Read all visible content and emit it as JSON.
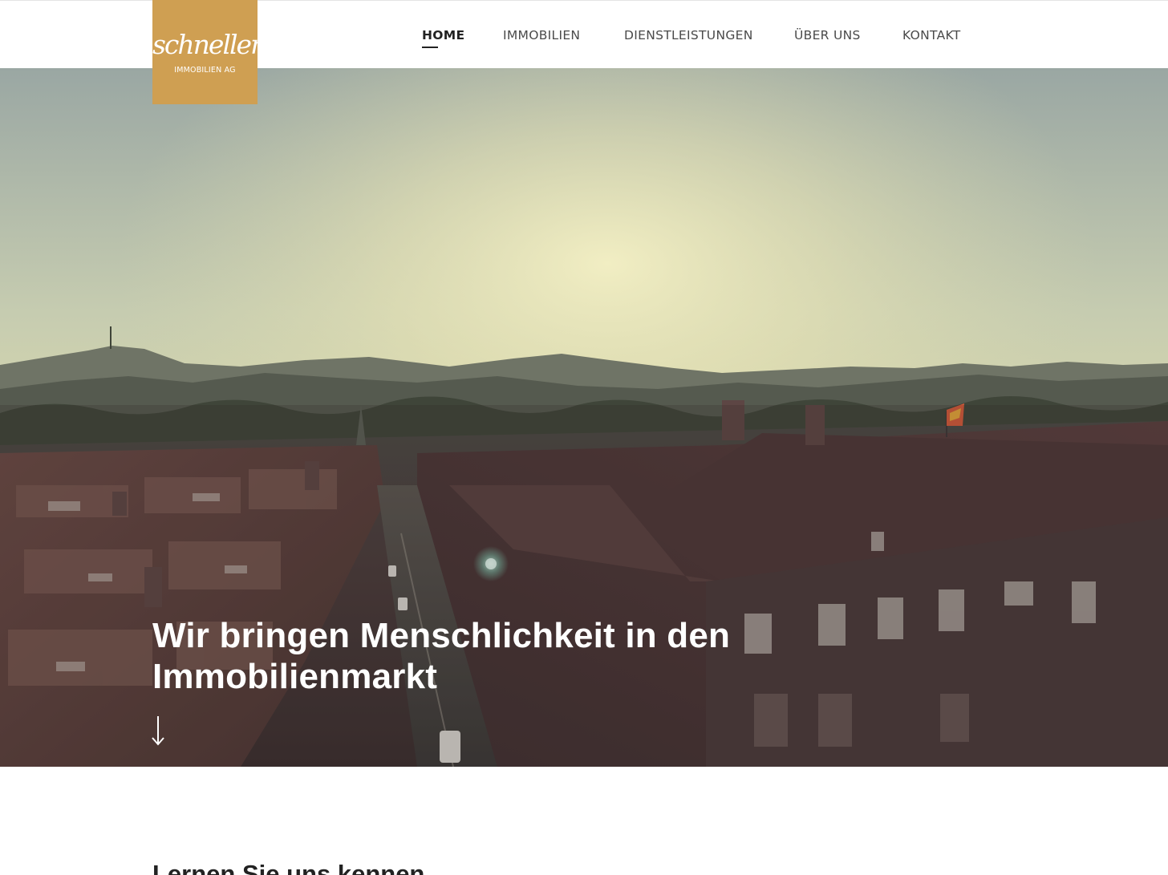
{
  "logo": {
    "script_text": "schneller",
    "subtitle": "IMMOBILIEN AG"
  },
  "nav": {
    "items": [
      {
        "label": "HOME",
        "active": true
      },
      {
        "label": "IMMOBILIEN",
        "active": false
      },
      {
        "label": "DIENSTLEISTUNGEN",
        "active": false
      },
      {
        "label": "ÜBER UNS",
        "active": false
      },
      {
        "label": "KONTAKT",
        "active": false
      }
    ]
  },
  "hero": {
    "title_line1": "Wir bringen Menschlichkeit in den",
    "title_line2": "Immobilienmarkt",
    "scroll_icon": "arrow-down-icon"
  },
  "intro": {
    "heading": "Lernen Sie uns kennen"
  },
  "colors": {
    "brand_gold": "#cf9f52",
    "header_bg": "#ffffff",
    "nav_text": "#4a4a4a",
    "hero_text": "#ffffff"
  }
}
